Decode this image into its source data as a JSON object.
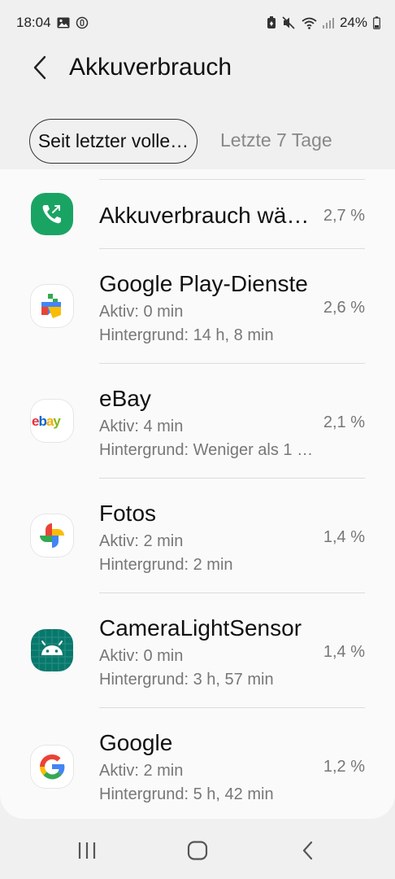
{
  "status_bar": {
    "time": "18:04",
    "left_icons": [
      "gallery-icon",
      "data-saver-icon"
    ],
    "right_icons": [
      "battery-saver-icon",
      "mute-icon",
      "wifi-icon",
      "signal-icon"
    ],
    "battery": "24%"
  },
  "header": {
    "title": "Akkuverbrauch",
    "back_icon": "back-arrow-icon"
  },
  "tabs": [
    {
      "label": "Seit letzter volle…",
      "active": true
    },
    {
      "label": "Letzte 7 Tage",
      "active": false
    }
  ],
  "apps": [
    {
      "name": "Akkuverbrauch wä…",
      "active": "",
      "background": "",
      "percent": "2,7 %",
      "icon": "call-transfer-icon"
    },
    {
      "name": "Google Play-Dienste",
      "active": "Aktiv: 0 min",
      "background": "Hintergrund: 14 h, 8 min",
      "percent": "2,6 %",
      "icon": "google-play-services-icon"
    },
    {
      "name": "eBay",
      "active": "Aktiv: 4 min",
      "background": "Hintergrund: Weniger als 1 …",
      "percent": "2,1 %",
      "icon": "ebay-icon"
    },
    {
      "name": "Fotos",
      "active": "Aktiv: 2 min",
      "background": "Hintergrund: 2 min",
      "percent": "1,4 %",
      "icon": "google-photos-icon"
    },
    {
      "name": "CameraLightSensor",
      "active": "Aktiv: 0 min",
      "background": "Hintergrund: 3 h, 57 min",
      "percent": "1,4 %",
      "icon": "android-icon"
    },
    {
      "name": "Google",
      "active": "Aktiv: 2 min",
      "background": "Hintergrund: 5 h, 42 min",
      "percent": "1,2 %",
      "icon": "google-icon"
    }
  ],
  "nav_bar": {
    "buttons": [
      "recents-icon",
      "home-icon",
      "back-icon"
    ]
  }
}
